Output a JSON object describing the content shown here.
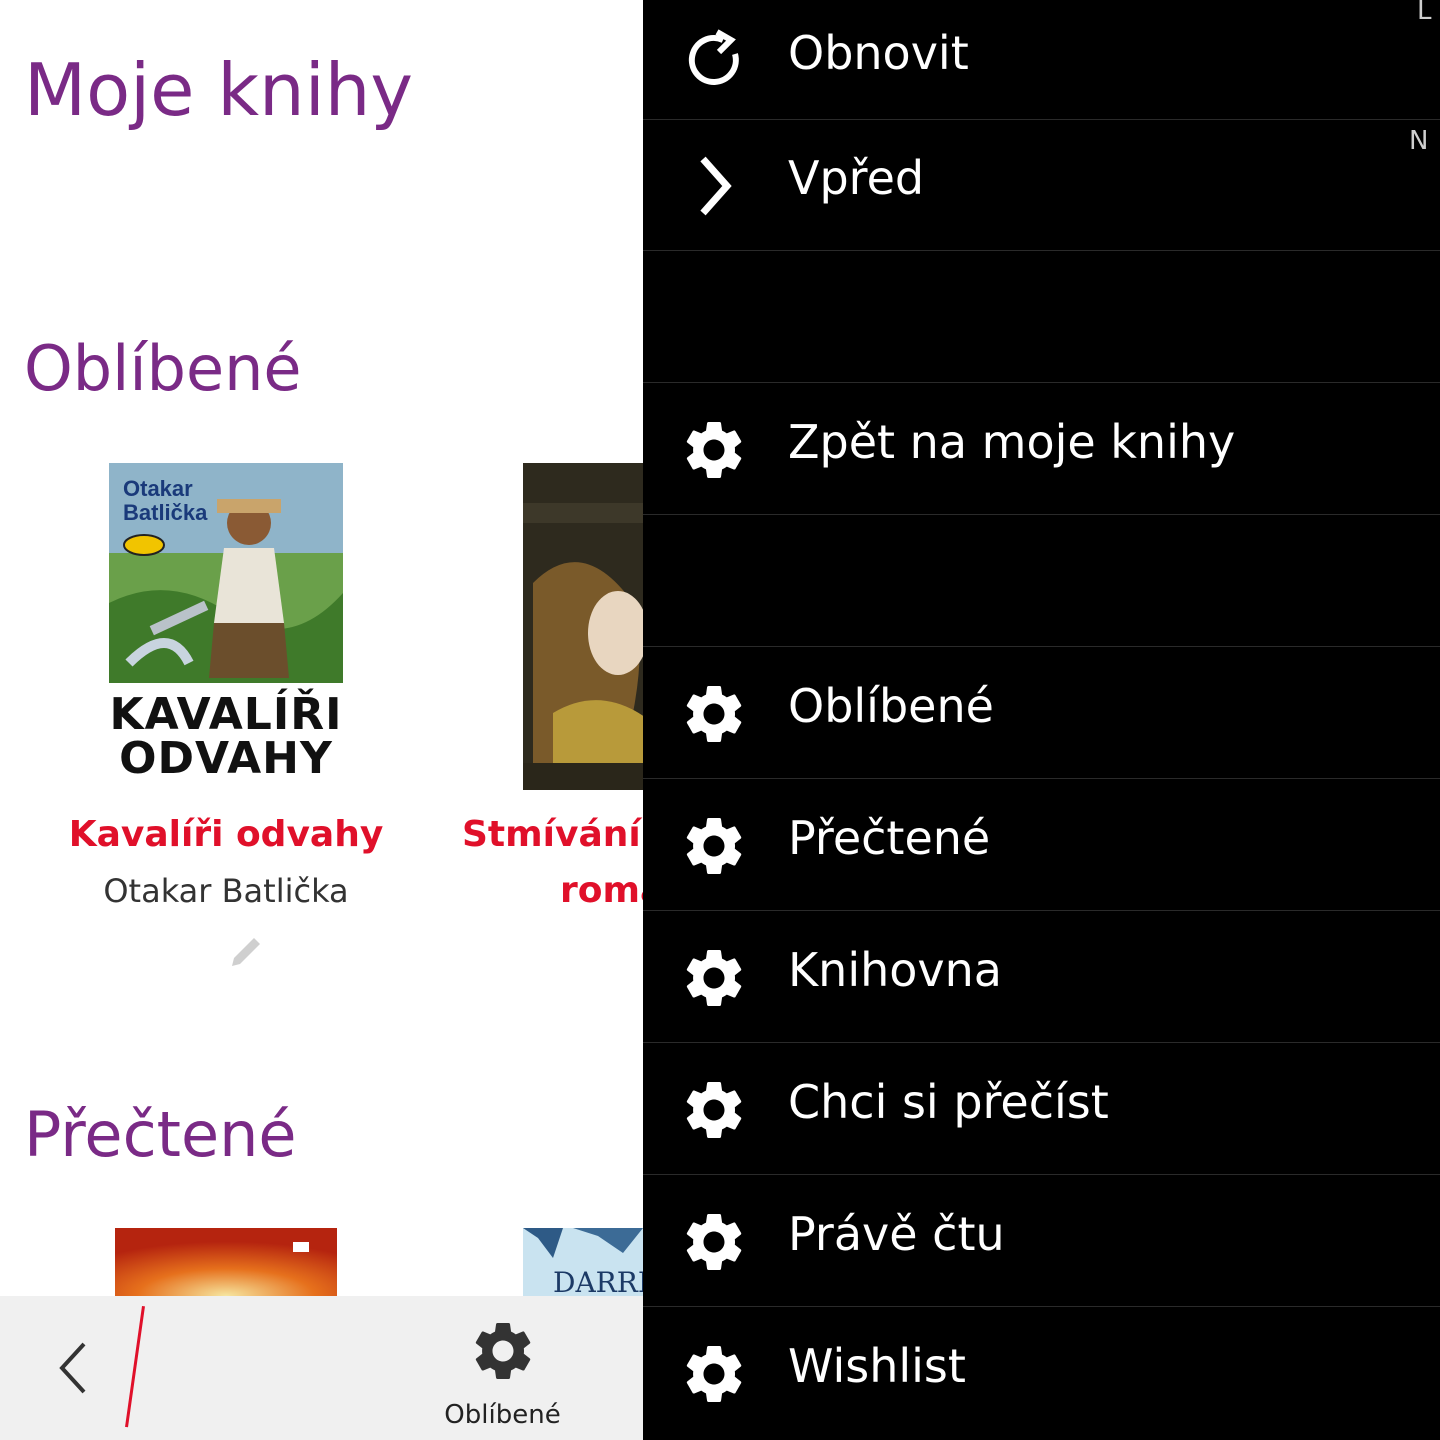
{
  "page": {
    "title": "Moje knihy",
    "sections": [
      {
        "title": "Oblíbené"
      },
      {
        "title": "Přečtené"
      }
    ]
  },
  "books": [
    {
      "title": "Kavalíři odvahy",
      "author": "Otakar Batlička",
      "cover_author": "Otakar Batlička",
      "cover_title_line1": "KAVALÍŘI",
      "cover_title_line2": "ODVAHY"
    },
    {
      "title_visible": "Stmívání:",
      "title_line2_visible": "roma"
    }
  ],
  "bottom_bar": {
    "tab_label": "Oblíbené"
  },
  "menu": {
    "items": [
      {
        "label": "Obnovit",
        "icon": "refresh-icon"
      },
      {
        "label": "Vpřed",
        "icon": "chevron-right-icon"
      },
      {
        "label": ""
      },
      {
        "label": "Zpět na moje knihy",
        "icon": "gear-icon"
      },
      {
        "label": ""
      },
      {
        "label": "Oblíbené",
        "icon": "gear-icon"
      },
      {
        "label": "Přečtené",
        "icon": "gear-icon"
      },
      {
        "label": "Knihovna",
        "icon": "gear-icon"
      },
      {
        "label": "Chci si přečíst",
        "icon": "gear-icon"
      },
      {
        "label": "Právě čtu",
        "icon": "gear-icon"
      },
      {
        "label": "Wishlist",
        "icon": "gear-icon"
      }
    ]
  },
  "edge_letters": [
    "L",
    "N"
  ],
  "colors": {
    "accent": "#7a2a86",
    "book_title": "#e0102a",
    "menu_bg": "#000000"
  }
}
